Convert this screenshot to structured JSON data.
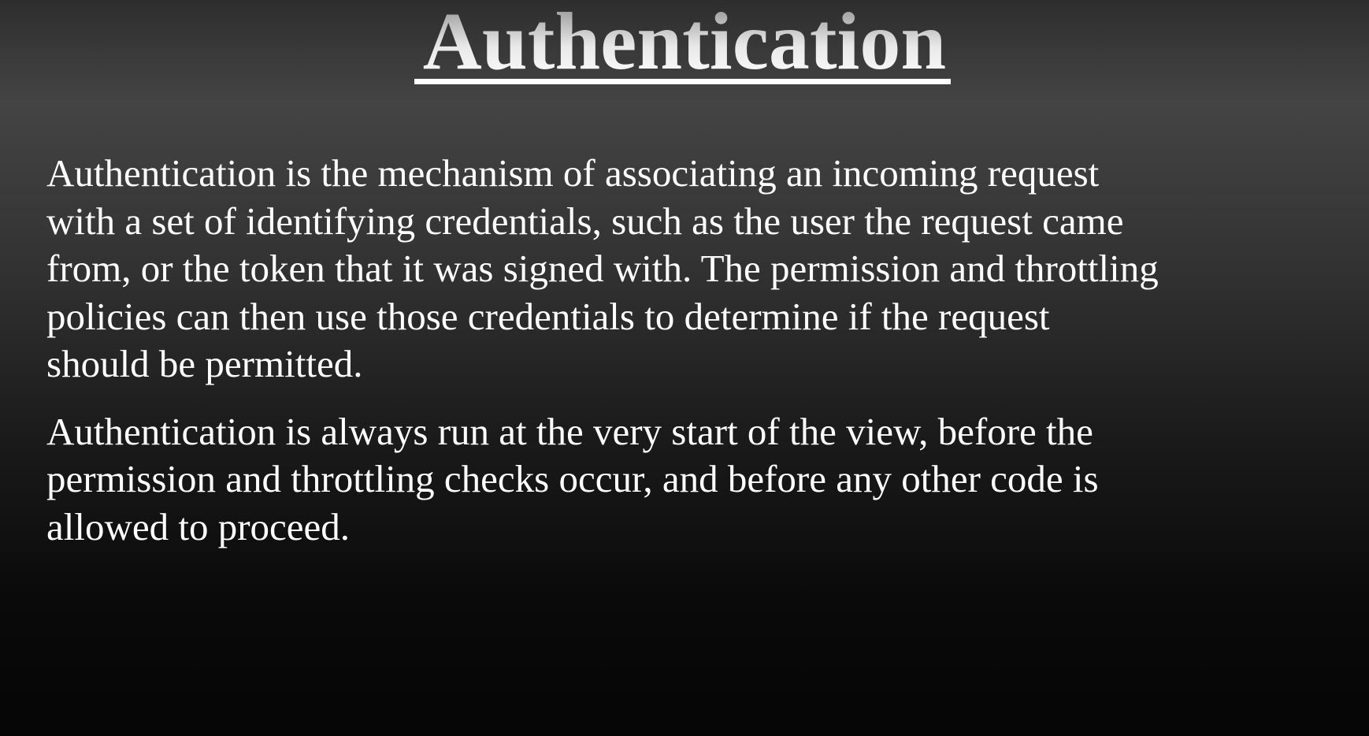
{
  "slide": {
    "title": "Authentication",
    "paragraphs": [
      "Authentication is the mechanism of associating an incoming request\nwith a set of identifying credentials, such as the user the request came\nfrom, or the token that it was signed with. The permission and throttling\npolicies can then use those credentials to determine if the request\nshould be permitted.",
      "Authentication is always run at the very start of the view, before the\npermission and throttling checks occur, and before any other code is\nallowed to proceed."
    ]
  }
}
